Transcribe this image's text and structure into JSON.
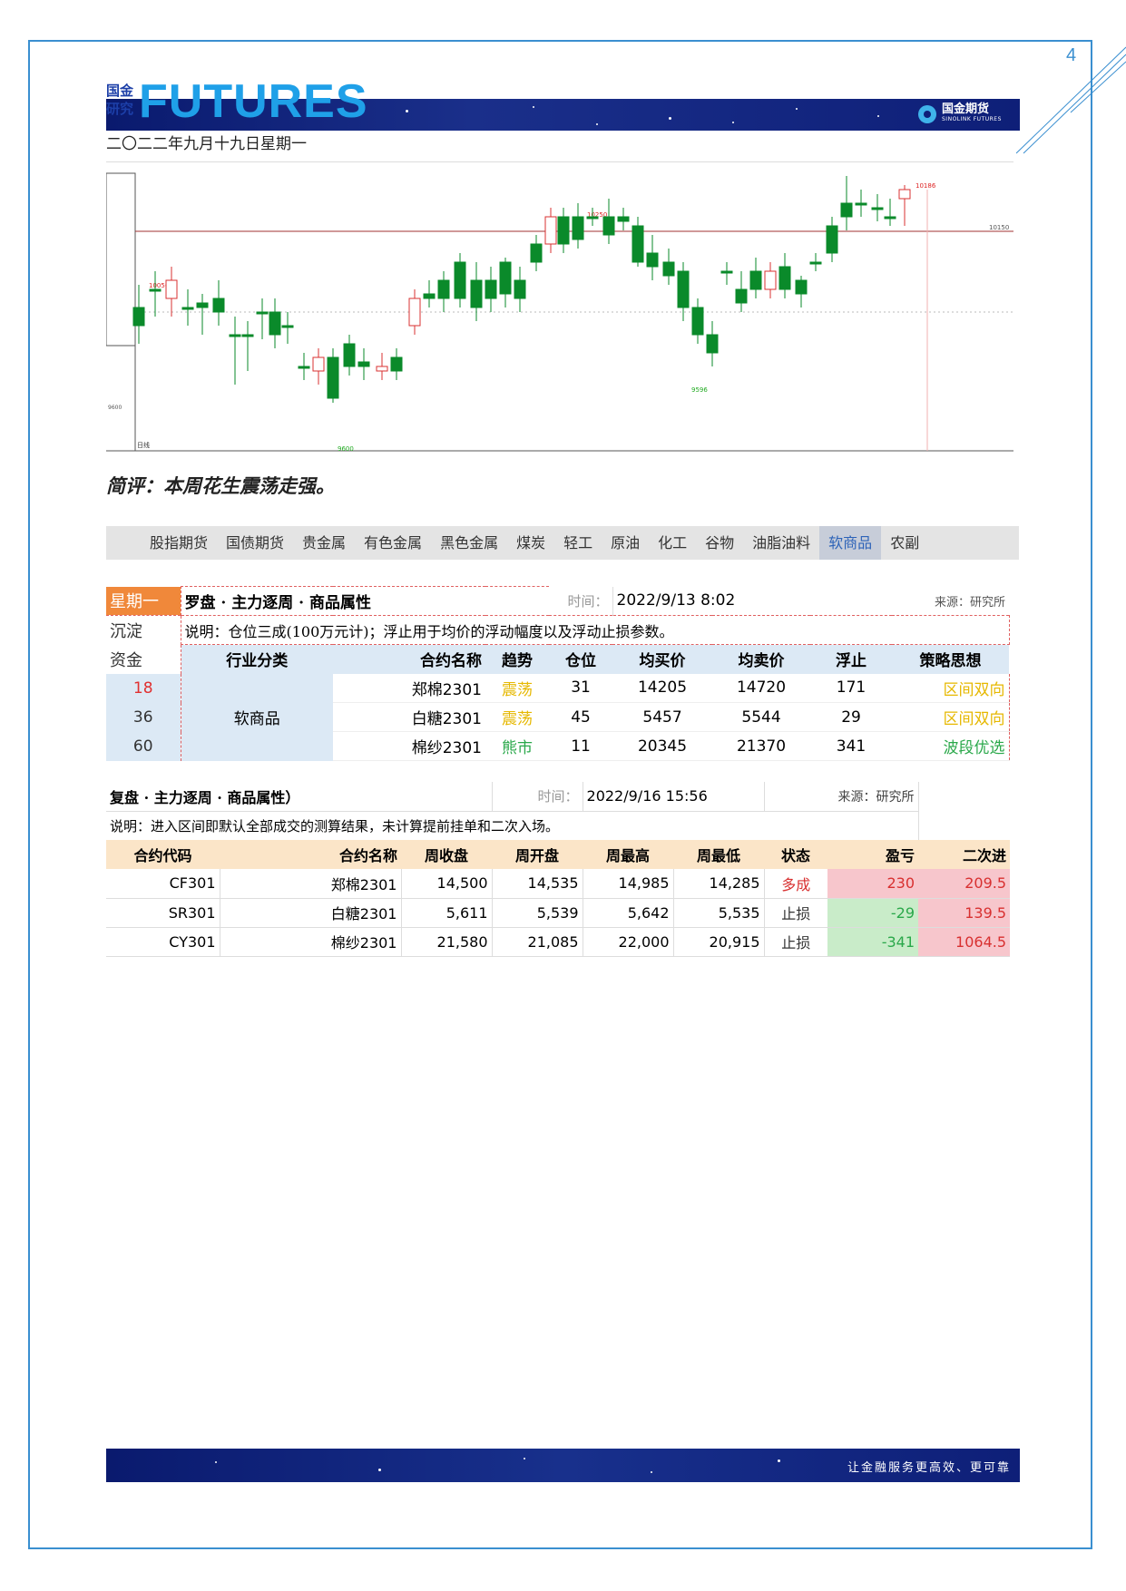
{
  "page_number": "4",
  "header": {
    "logo_small_line1": "国金",
    "logo_small_line2": "研究",
    "logo_big": "FUTURES",
    "brand_cn": "国金期货",
    "brand_en": "SINOLINK FUTURES"
  },
  "date_line": "二〇二二年九月十九日星期一",
  "comment": "简评：本周花生震荡走强。",
  "nav": {
    "items": [
      "股指期货",
      "国债期货",
      "贵金属",
      "有色金属",
      "黑色金属",
      "煤炭",
      "轻工",
      "原油",
      "化工",
      "谷物",
      "油脂油料",
      "软商品",
      "农副"
    ],
    "active": "软商品"
  },
  "chart_data": {
    "type": "candlestick",
    "price_labels": [
      "10050",
      "10250",
      "9596",
      "10186",
      "9600",
      "10150"
    ],
    "axis_left_label": "9600",
    "bottom_left_label": "日线"
  },
  "plan_table": {
    "weekday_label": "星期一",
    "title": "罗盘 · 主力逐周 · 商品属性",
    "time_label": "时间：",
    "time_value": "2022/9/13 8:02",
    "source": "来源：研究所",
    "side_labels": [
      "沉淀",
      "资金"
    ],
    "note": "说明：仓位三成(100万元计)；浮止用于均价的浮动幅度以及浮动止损参数。",
    "headers": [
      "行业分类",
      "合约名称",
      "趋势",
      "仓位",
      "均买价",
      "均卖价",
      "浮止",
      "策略思想"
    ],
    "category": "软商品",
    "rows": [
      {
        "fund": "18",
        "name": "郑棉2301",
        "trend": "震荡",
        "position": "31",
        "buy": "14205",
        "sell": "14720",
        "stop": "171",
        "strategy": "区间双向"
      },
      {
        "fund": "36",
        "name": "白糖2301",
        "trend": "震荡",
        "position": "45",
        "buy": "5457",
        "sell": "5544",
        "stop": "29",
        "strategy": "区间双向"
      },
      {
        "fund": "60",
        "name": "棉纱2301",
        "trend": "熊市",
        "position": "11",
        "buy": "20345",
        "sell": "21370",
        "stop": "341",
        "strategy": "波段优选"
      }
    ],
    "colors": {
      "weekday_bg": "#f0883a",
      "side_bg": "#dce9f5",
      "zhendang": "#e6b800",
      "xiongshi": "#2aa84a",
      "range": "#e6b800",
      "wave": "#2aa84a",
      "fund_red": "#e03030"
    }
  },
  "review_table": {
    "title": "复盘 · 主力逐周 · 商品属性）",
    "time_label": "时间：",
    "time_value": "2022/9/16 15:56",
    "source": "来源：研究所",
    "note": "说明：进入区间即默认全部成交的测算结果，未计算提前挂单和二次入场。",
    "headers": [
      "合约代码",
      "合约名称",
      "周收盘",
      "周开盘",
      "周最高",
      "周最低",
      "状态",
      "盈亏",
      "二次进"
    ],
    "rows": [
      {
        "code": "CF301",
        "name": "郑棉2301",
        "close": "14,500",
        "open": "14,535",
        "high": "14,985",
        "low": "14,285",
        "status": "多成",
        "pnl": "230",
        "second": "209.5"
      },
      {
        "code": "SR301",
        "name": "白糖2301",
        "close": "5,611",
        "open": "5,539",
        "high": "5,642",
        "low": "5,535",
        "status": "止损",
        "pnl": "-29",
        "second": "139.5"
      },
      {
        "code": "CY301",
        "name": "棉纱2301",
        "close": "21,580",
        "open": "21,085",
        "high": "22,000",
        "low": "20,915",
        "status": "止损",
        "pnl": "-341",
        "second": "1064.5"
      }
    ],
    "colors": {
      "header_bg": "#fbe5c8",
      "profit_bg": "#f7c6cc",
      "loss_bg": "#c9ecc9",
      "red_text": "#d83030",
      "green_text": "#2aa84a"
    }
  },
  "footer": {
    "slogan": "让金融服务更高效、更可靠"
  }
}
